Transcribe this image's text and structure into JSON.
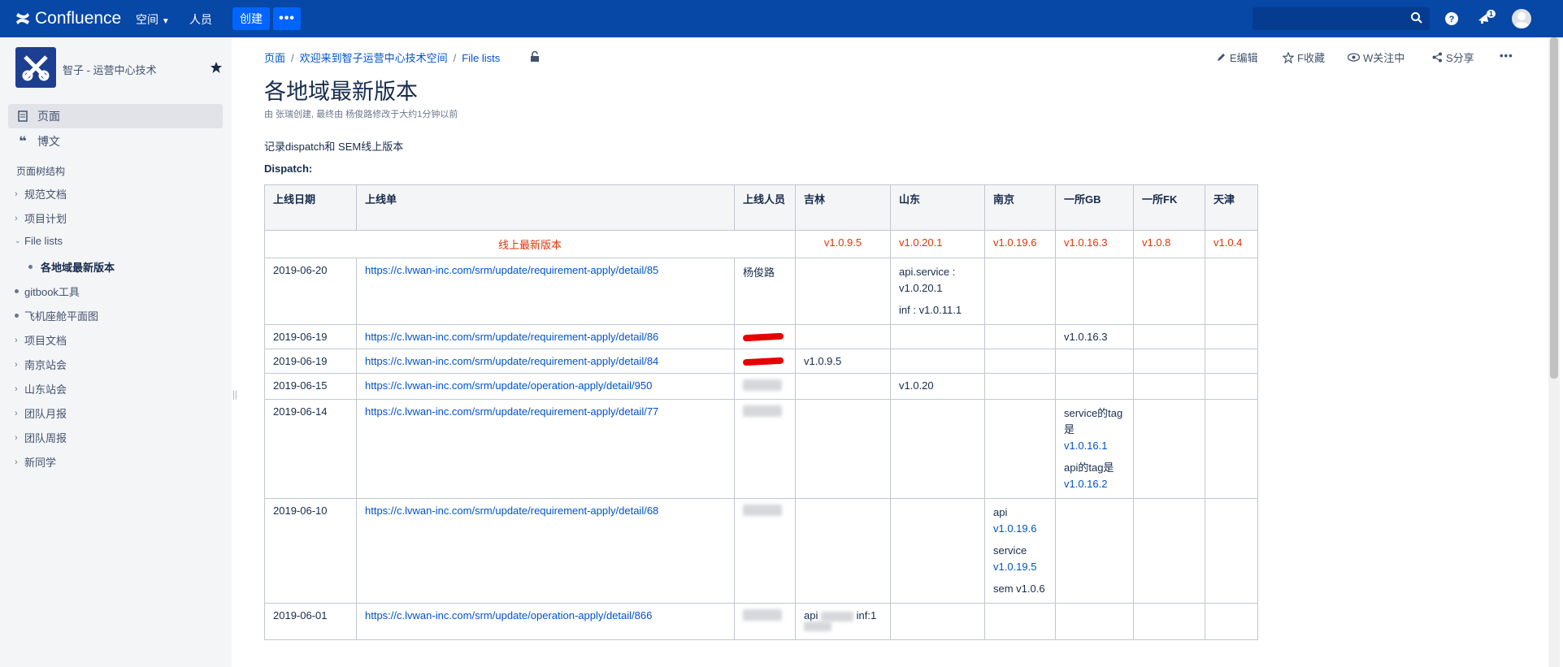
{
  "topbar": {
    "brand": "Confluence",
    "spaces_label": "空间",
    "people_label": "人员",
    "create_label": "创建",
    "more_label": "•••",
    "notif_count": "1"
  },
  "sidebar": {
    "space_name": "智子 - 运营中心技术",
    "pages_label": "页面",
    "blog_label": "博文",
    "tree_heading": "页面树结构",
    "tree": [
      {
        "label": "规范文档"
      },
      {
        "label": "项目计划"
      },
      {
        "label": "File lists"
      },
      {
        "label": "各地域最新版本"
      },
      {
        "label": "gitbook工具"
      },
      {
        "label": "飞机座舱平面图"
      },
      {
        "label": "项目文档"
      },
      {
        "label": "南京站会"
      },
      {
        "label": "山东站会"
      },
      {
        "label": "团队月报"
      },
      {
        "label": "团队周报"
      },
      {
        "label": "新同学"
      }
    ]
  },
  "breadcrumb": [
    "页面",
    "欢迎来到智子运营中心技术空间",
    "File lists"
  ],
  "actions": {
    "edit": "E编辑",
    "save": "F收藏",
    "watch": "W关注中",
    "share": "S分享",
    "more": "•••"
  },
  "page": {
    "title": "各地域最新版本",
    "byline": "由 张瑞创建, 最终由 杨俊路修改于大约1分钟以前",
    "description": "记录dispatch和 SEM线上版本",
    "section_label": "Dispatch:"
  },
  "table": {
    "headers": [
      "上线日期",
      "上线单",
      "上线人员",
      "吉林",
      "山东",
      "南京",
      "一所GB",
      "一所FK",
      "天津"
    ],
    "latest_label": "线上最新版本",
    "latest": [
      "v1.0.9.5",
      "v1.0.20.1",
      "v1.0.19.6",
      "v1.0.16.3",
      "v1.0.8",
      "v1.0.4"
    ],
    "rows": [
      {
        "date": "2019-06-20",
        "link": "https://c.lvwan-inc.com/srm/update/requirement-apply/detail/85",
        "person": "杨俊路",
        "shandong_1": "api.service : v1.0.20.1",
        "shandong_2": "inf : v1.0.11.1"
      },
      {
        "date": "2019-06-19",
        "link": "https://c.lvwan-inc.com/srm/update/requirement-apply/detail/86",
        "gb": "v1.0.16.3"
      },
      {
        "date": "2019-06-19",
        "link": "https://c.lvwan-inc.com/srm/update/requirement-apply/detail/84",
        "jilin": "v1.0.9.5"
      },
      {
        "date": "2019-06-15",
        "link": "https://c.lvwan-inc.com/srm/update/operation-apply/detail/950",
        "shandong": "v1.0.20"
      },
      {
        "date": "2019-06-14",
        "link": "https://c.lvwan-inc.com/srm/update/requirement-apply/detail/77",
        "gb_1a": "service的tag是",
        "gb_1b": "v1.0.16.1",
        "gb_2a": "api的tag是",
        "gb_2b": "v1.0.16.2"
      },
      {
        "date": "2019-06-10",
        "link": "https://c.lvwan-inc.com/srm/update/requirement-apply/detail/68",
        "nj_1a": "api",
        "nj_1b": "v1.0.19.6",
        "nj_2a": "service",
        "nj_2b": "v1.0.19.5",
        "nj_3": "sem v1.0.6"
      },
      {
        "date": "2019-06-01",
        "link": "https://c.lvwan-inc.com/srm/update/operation-apply/detail/866",
        "jilin_a": "api",
        "jilin_b": "inf:1"
      }
    ]
  },
  "colors": {
    "brand": "#0747a6",
    "accent": "#0052cc",
    "highlight": "#de350b"
  }
}
